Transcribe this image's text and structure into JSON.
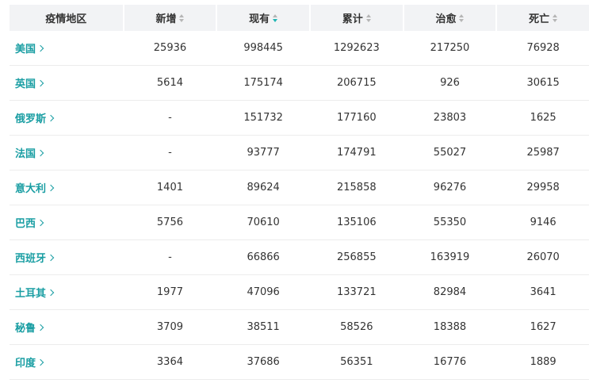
{
  "headers": {
    "region": "疫情地区",
    "new": "新增",
    "current": "现有",
    "total": "累计",
    "cured": "治愈",
    "deaths": "死亡"
  },
  "colors": {
    "header_bg": "#f2f3f5",
    "link": "#1a9ea3",
    "sort_active": "#1fb5b3",
    "sort_inactive": "#b5b5b5"
  },
  "active_sort": "current-descending",
  "rows": [
    {
      "region": "美国",
      "new": "25936",
      "current": "998445",
      "total": "1292623",
      "cured": "217250",
      "deaths": "76928"
    },
    {
      "region": "英国",
      "new": "5614",
      "current": "175174",
      "total": "206715",
      "cured": "926",
      "deaths": "30615"
    },
    {
      "region": "俄罗斯",
      "new": "-",
      "current": "151732",
      "total": "177160",
      "cured": "23803",
      "deaths": "1625"
    },
    {
      "region": "法国",
      "new": "-",
      "current": "93777",
      "total": "174791",
      "cured": "55027",
      "deaths": "25987"
    },
    {
      "region": "意大利",
      "new": "1401",
      "current": "89624",
      "total": "215858",
      "cured": "96276",
      "deaths": "29958"
    },
    {
      "region": "巴西",
      "new": "5756",
      "current": "70610",
      "total": "135106",
      "cured": "55350",
      "deaths": "9146"
    },
    {
      "region": "西班牙",
      "new": "-",
      "current": "66866",
      "total": "256855",
      "cured": "163919",
      "deaths": "26070"
    },
    {
      "region": "土耳其",
      "new": "1977",
      "current": "47096",
      "total": "133721",
      "cured": "82984",
      "deaths": "3641"
    },
    {
      "region": "秘鲁",
      "new": "3709",
      "current": "38511",
      "total": "58526",
      "cured": "18388",
      "deaths": "1627"
    },
    {
      "region": "印度",
      "new": "3364",
      "current": "37686",
      "total": "56351",
      "cured": "16776",
      "deaths": "1889"
    }
  ]
}
